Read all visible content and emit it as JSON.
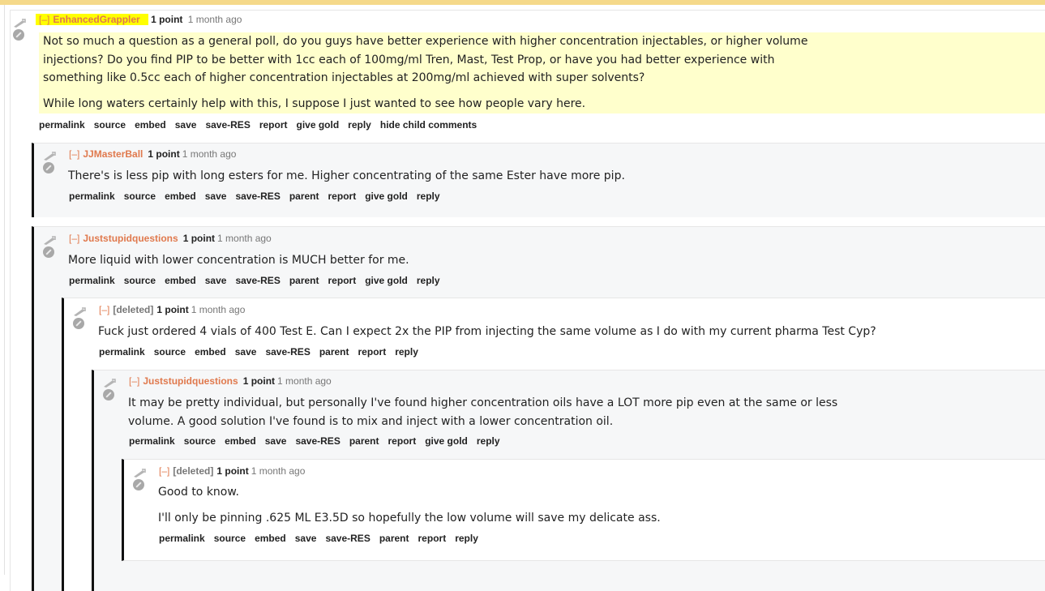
{
  "comments": [
    {
      "toggle": "[–]",
      "author": "EnhancedGrappler",
      "score": "1 point",
      "time": "1 month ago",
      "paragraphs": [
        "Not so much a question as a general poll, do you guys have better experience with higher concentration injectables, or higher volume injections? Do you find PIP to be better with 1cc each of 100mg/ml Tren, Mast, Test Prop, or have you had better experience with something like 0.5cc each of higher concentration injectables at 200mg/ml achieved with super solvents?",
        "While long waters certainly help with this, I suppose I just wanted to see how people vary here."
      ],
      "buttons": [
        "permalink",
        "source",
        "embed",
        "save",
        "save-RES",
        "report",
        "give gold",
        "reply",
        "hide child comments"
      ]
    },
    {
      "toggle": "[–]",
      "author": "JJMasterBall",
      "score": "1 point",
      "time": "1 month ago",
      "paragraphs": [
        "There's is less pip with long esters for me. Higher concentrating of the same Ester have more pip."
      ],
      "buttons": [
        "permalink",
        "source",
        "embed",
        "save",
        "save-RES",
        "parent",
        "report",
        "give gold",
        "reply"
      ]
    },
    {
      "toggle": "[–]",
      "author": "Juststupidquestions",
      "score": "1 point",
      "time": "1 month ago",
      "paragraphs": [
        "More liquid with lower concentration is MUCH better for me."
      ],
      "buttons": [
        "permalink",
        "source",
        "embed",
        "save",
        "save-RES",
        "parent",
        "report",
        "give gold",
        "reply"
      ]
    },
    {
      "toggle": "[–]",
      "author": "[deleted]",
      "score": "1 point",
      "time": "1 month ago",
      "paragraphs": [
        "Fuck just ordered 4 vials of 400 Test E. Can I expect 2x the PIP from injecting the same volume as I do with my current pharma Test Cyp?"
      ],
      "buttons": [
        "permalink",
        "source",
        "embed",
        "save",
        "save-RES",
        "parent",
        "report",
        "reply"
      ]
    },
    {
      "toggle": "[–]",
      "author": "Juststupidquestions",
      "score": "1 point",
      "time": "1 month ago",
      "paragraphs": [
        "It may be pretty individual, but personally I've found higher concentration oils have a LOT more pip even at the same or less volume. A good solution I've found is to mix and inject with a lower concentration oil."
      ],
      "buttons": [
        "permalink",
        "source",
        "embed",
        "save",
        "save-RES",
        "parent",
        "report",
        "give gold",
        "reply"
      ]
    },
    {
      "toggle": "[–]",
      "author": "[deleted]",
      "score": "1 point",
      "time": "1 month ago",
      "paragraphs": [
        "Good to know.",
        "I'll only be pinning .625 ML E3.5D so hopefully the low volume will save my delicate ass."
      ],
      "buttons": [
        "permalink",
        "source",
        "embed",
        "save",
        "save-RES",
        "parent",
        "report",
        "reply"
      ]
    }
  ]
}
